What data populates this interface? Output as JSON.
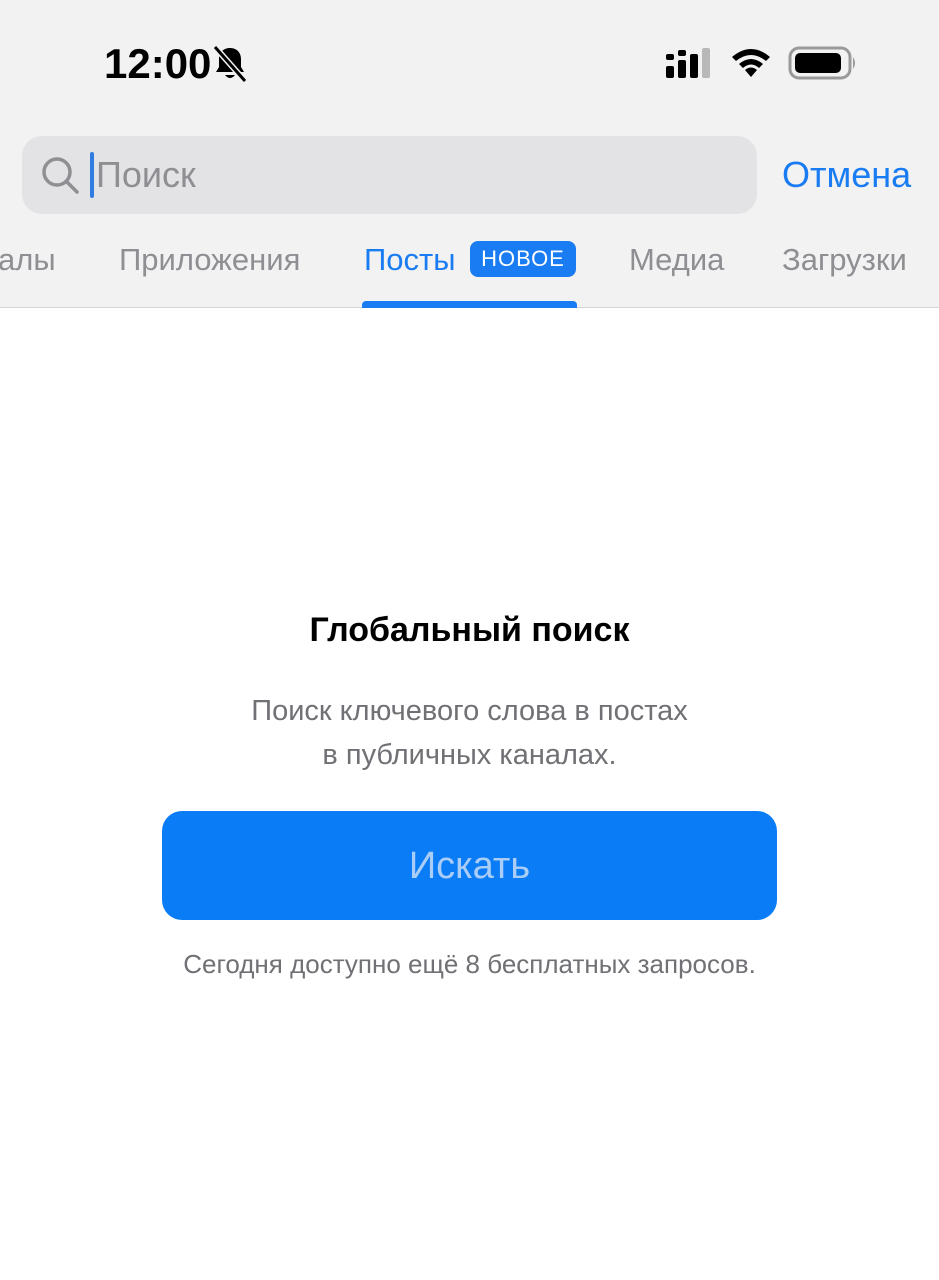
{
  "status_bar": {
    "time": "12:00",
    "icons": [
      "bell-slash-icon",
      "cellular-signal-icon",
      "wifi-icon",
      "battery-icon"
    ]
  },
  "search": {
    "value": "",
    "placeholder": "Поиск",
    "cancel_label": "Отмена"
  },
  "tabs": [
    {
      "label": "алы",
      "active": false
    },
    {
      "label": "Приложения",
      "active": false
    },
    {
      "label": "Посты",
      "active": true,
      "badge": "НОВОЕ"
    },
    {
      "label": "Медиа",
      "active": false
    },
    {
      "label": "Загрузки",
      "active": false
    }
  ],
  "empty_state": {
    "title": "Глобальный поиск",
    "subtitle_lines": [
      "Поиск ключевого слова в постах",
      "в публичных каналах."
    ],
    "button_label": "Искать",
    "note": "Сегодня доступно ещё 8 бесплатных запросов."
  },
  "colors": {
    "accent": "#1a7cf2",
    "button": "#0a7cf5",
    "button_text_disabled": "#a9cdf6",
    "header_background": "#f2f2f2",
    "search_field": "#e3e3e5",
    "secondary_text": "#8e8e93"
  }
}
